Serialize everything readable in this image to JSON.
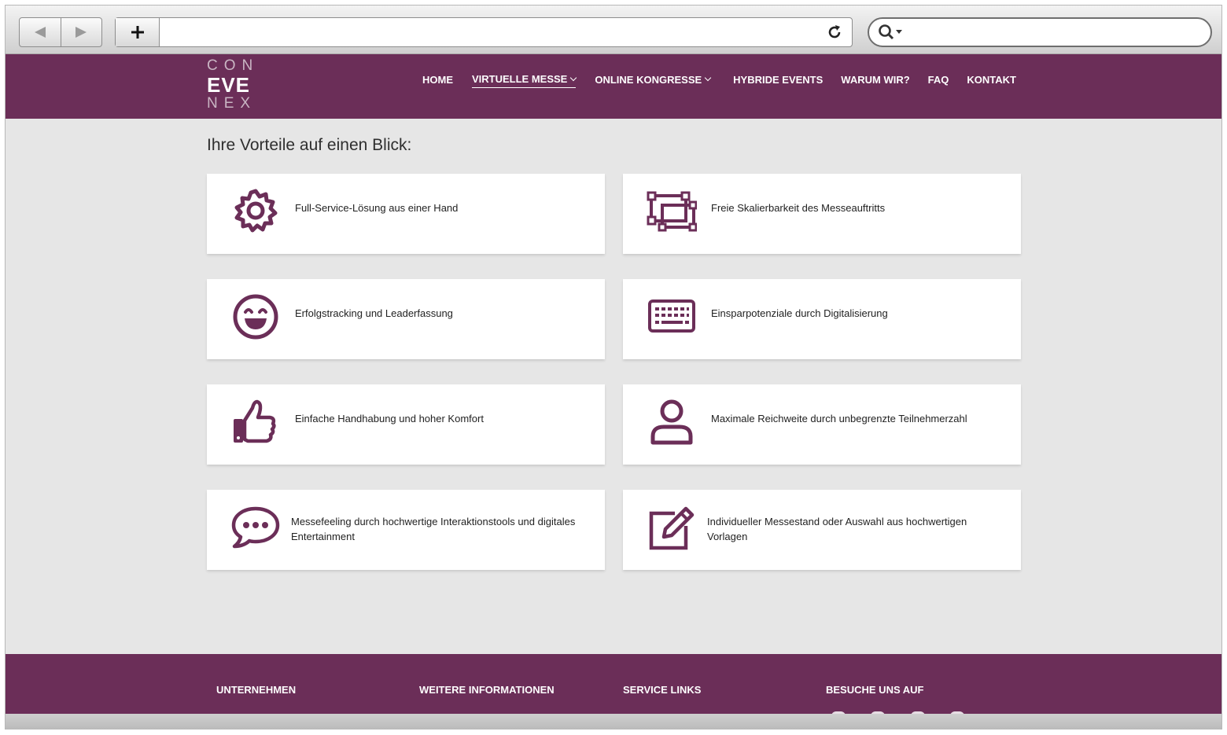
{
  "browser": {
    "url_value": "",
    "search_value": ""
  },
  "site": {
    "logo": {
      "top": "CON",
      "middle": "EVE",
      "bottom": "NEX"
    },
    "nav": [
      {
        "label": "HOME"
      },
      {
        "label": "VIRTUELLE MESSE"
      },
      {
        "label": "ONLINE KONGRESSE"
      },
      {
        "label": "HYBRIDE EVENTS"
      },
      {
        "label": "WARUM WIR?"
      },
      {
        "label": "FAQ"
      },
      {
        "label": "KONTAKT"
      }
    ]
  },
  "main": {
    "heading": "Ihre Vorteile auf einen Blick:",
    "cards": [
      {
        "icon": "gear-icon",
        "text": "Full-Service-Lösung aus einer Hand"
      },
      {
        "icon": "scale-frame-icon",
        "text": "Freie Skalierbarkeit des Messeauftritts"
      },
      {
        "icon": "smiley-icon",
        "text": "Erfolgstracking und Leaderfassung"
      },
      {
        "icon": "keyboard-icon",
        "text": "Einsparpotenziale durch Digitalisierung"
      },
      {
        "icon": "thumbs-up-icon",
        "text": "Einfache Handhabung und hoher Komfort"
      },
      {
        "icon": "user-icon",
        "text": "Maximale Reichweite durch unbegrenzte Teilnehmerzahl"
      },
      {
        "icon": "chat-bubble-icon",
        "text": "Messefeeling durch hochwertige Interaktionstools und digitales Entertainment"
      },
      {
        "icon": "edit-icon",
        "text": "Individueller Messestand oder Auswahl aus hochwertigen Vorlagen"
      }
    ]
  },
  "footer": {
    "columns": [
      {
        "title": "UNTERNEHMEN"
      },
      {
        "title": "WEITERE INFORMATIONEN"
      },
      {
        "title": "SERVICE LINKS"
      },
      {
        "title": "BESUCHE UNS AUF"
      }
    ]
  },
  "colors": {
    "brand": "#6b2e58",
    "background": "#e6e6e6",
    "card": "#ffffff"
  }
}
